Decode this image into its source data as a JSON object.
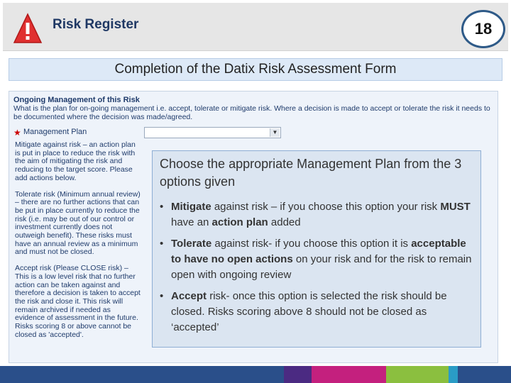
{
  "header": {
    "app_title": "Risk Register",
    "page_number": "18",
    "icon": "warning-triangle-icon"
  },
  "section_title": "Completion of the Datix Risk Assessment Form",
  "form": {
    "heading": "Ongoing Management of this Risk",
    "description": "What is the plan for on-going management i.e. accept, tolerate or mitigate risk. Where a decision is made to accept or tolerate the risk it needs to be documented where the decision was made/agreed.",
    "required_marker": "★",
    "field_label": "Management Plan",
    "select_value": "",
    "help": [
      "Mitigate against risk – an action plan is put in place to reduce the risk with the aim of mitigating the risk and reducing to the target score. Please add actions below.",
      "Tolerate risk (Minimum annual review) – there are no further actions that can be put in place currently to reduce the risk (i.e. may be out of our control or investment currently does not outweigh benefit). These risks must have an annual review as a minimum and must not be closed.",
      "Accept risk (Please CLOSE risk) – This is a low level risk that no further action can be taken against and therefore a decision is taken to accept the risk and close it. This risk will remain archived if needed as evidence of assessment in the future. Risks scoring 8 or above cannot be closed as 'accepted'."
    ]
  },
  "callout": {
    "intro": "Choose the appropriate Management Plan from the 3 options given",
    "bullets": [
      {
        "b1": "Mitigate",
        "t1": " against risk – if you choose this option your risk ",
        "b2": "MUST",
        "t2": " have an ",
        "b3": "action plan",
        "t3": " added"
      },
      {
        "b1": "Tolerate",
        "t1": " against risk- if you choose this option it is ",
        "b2": "acceptable to have no open actions",
        "t2": " on your risk and for the risk to remain open with ongoing review"
      },
      {
        "b1": "Accept",
        "t1": " risk- once this option is selected the risk should be closed. Risks scoring above 8 should not be closed as ‘accepted’"
      }
    ]
  },
  "colors": {
    "header_bg": "#e6e6e6",
    "title_color": "#1f3864",
    "badge_border": "#2e5a88",
    "callout_bg": "#dbe5f1",
    "strip": [
      "#2a4f8a",
      "#2a4f8a",
      "#2a4f8a",
      "#2a4f8a",
      "#2a4f8a",
      "#4b2a82",
      "#c4207e",
      "#8bbf3f",
      "#2a9cc6",
      "#2a4f8a"
    ]
  }
}
